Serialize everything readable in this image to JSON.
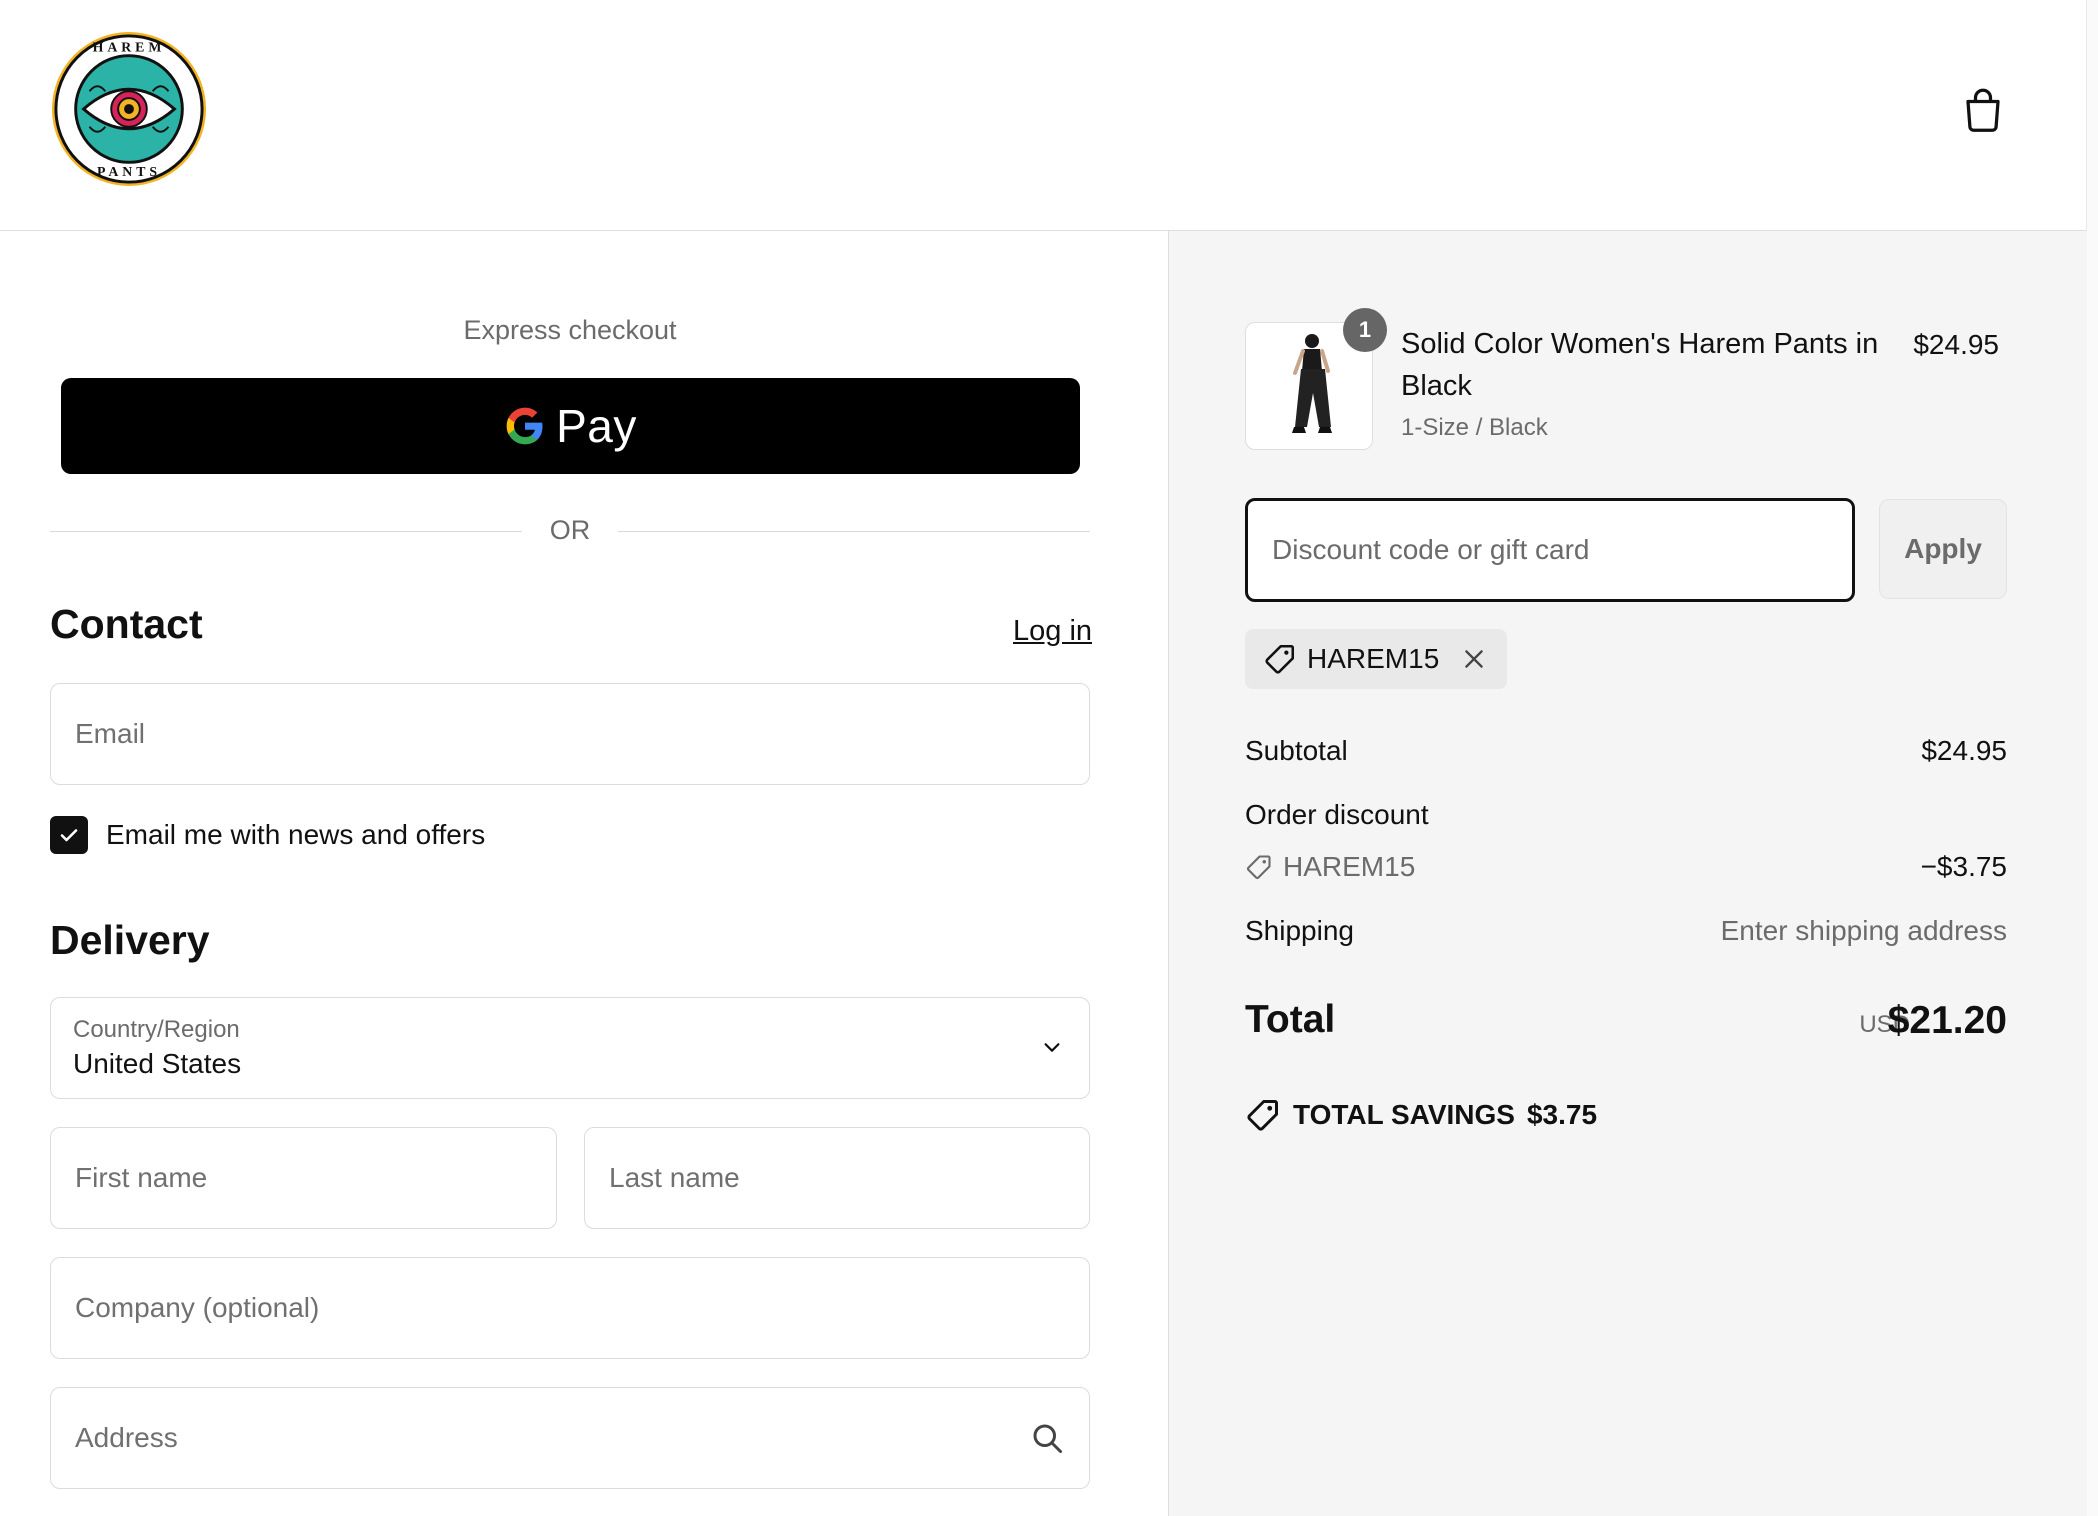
{
  "header": {
    "logo_alt": "Harem Pants",
    "logo_top_text": "HAREM",
    "logo_bottom_text": "PANTS",
    "cart_icon": "shopping-bag-icon"
  },
  "express": {
    "title": "Express checkout",
    "gpay_label": "Pay",
    "or_label": "OR"
  },
  "contact": {
    "heading": "Contact",
    "login_label": "Log in",
    "email_placeholder": "Email",
    "newsletter_label": "Email me with news and offers",
    "newsletter_checked": true
  },
  "delivery": {
    "heading": "Delivery",
    "country_label": "Country/Region",
    "country_value": "United States",
    "first_name_placeholder": "First name",
    "last_name_placeholder": "Last name",
    "company_placeholder": "Company (optional)",
    "address_placeholder": "Address"
  },
  "order": {
    "item": {
      "quantity": "1",
      "name": "Solid Color Women's Harem Pants in Black",
      "variant": "1-Size / Black",
      "price": "$24.95"
    },
    "discount_placeholder": "Discount code or gift card",
    "apply_label": "Apply",
    "applied_code": "HAREM15",
    "subtotal_label": "Subtotal",
    "subtotal_value": "$24.95",
    "order_discount_label": "Order discount",
    "discount_code": "HAREM15",
    "discount_value": "−$3.75",
    "shipping_label": "Shipping",
    "shipping_value": "Enter shipping address",
    "total_label": "Total",
    "total_currency": "USD",
    "total_value": "$21.20",
    "savings_label": "TOTAL SAVINGS",
    "savings_value": "$3.75"
  },
  "colors": {
    "accent": "#111111",
    "logo_teal": "#2bb3a8",
    "logo_yellow": "#f3b323",
    "logo_pink": "#d6245a"
  }
}
